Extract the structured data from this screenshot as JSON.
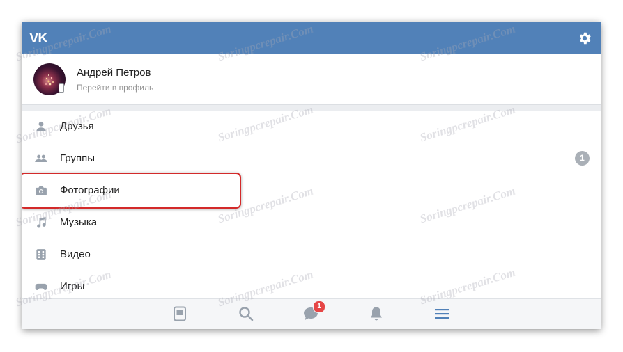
{
  "app": {
    "logo_text": "VK",
    "brand_color": "#5181b8"
  },
  "header": {
    "settings_icon": "gear-icon"
  },
  "profile": {
    "name": "Андрей Петров",
    "link_text": "Перейти в профиль",
    "status_icon": "mobile-icon"
  },
  "menu": {
    "items": [
      {
        "label": "Друзья",
        "icon": "person-icon"
      },
      {
        "label": "Группы",
        "icon": "people-icon",
        "counter": "1"
      },
      {
        "label": "Фотографии",
        "icon": "camera-icon",
        "highlighted": true
      },
      {
        "label": "Музыка",
        "icon": "music-note-icon"
      },
      {
        "label": "Видео",
        "icon": "film-icon"
      },
      {
        "label": "Игры",
        "icon": "gamepad-icon"
      }
    ]
  },
  "bottom_nav": {
    "tabs": [
      {
        "icon": "news-icon"
      },
      {
        "icon": "search-icon"
      },
      {
        "icon": "messages-icon",
        "badge": "1"
      },
      {
        "icon": "bell-icon"
      },
      {
        "icon": "menu-icon",
        "active": true
      }
    ],
    "accent_color": "#5181b8",
    "badge_color": "#e64646"
  },
  "watermark": {
    "text": "Soringpcrepair.Com"
  }
}
